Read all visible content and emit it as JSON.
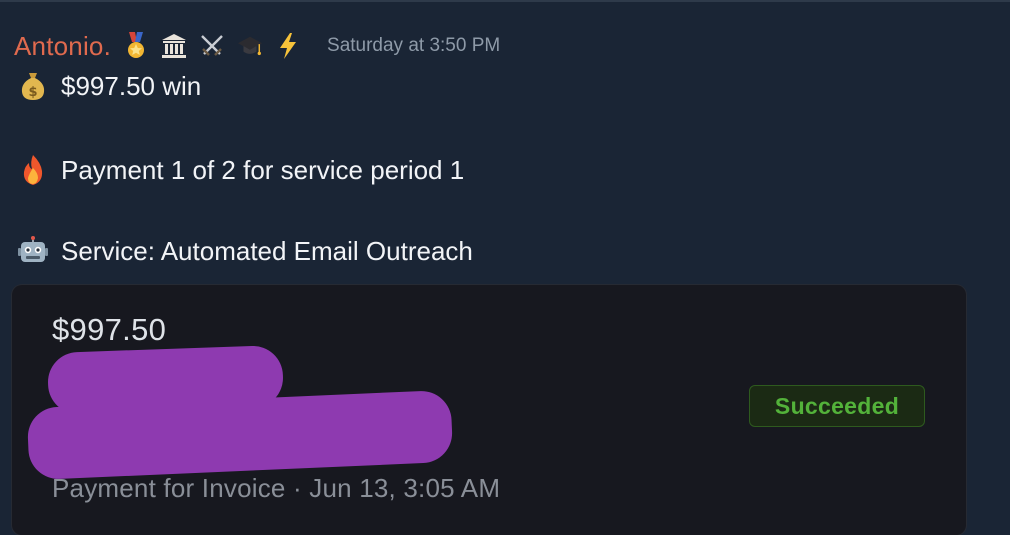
{
  "message": {
    "author": "Antonio.",
    "badges": [
      "medal-icon",
      "classical-building-icon",
      "crossed-swords-icon",
      "graduation-cap-icon",
      "lightning-icon"
    ],
    "timestamp": "Saturday at 3:50 PM",
    "lines": [
      {
        "icon": "money-bag-icon",
        "text": "$997.50 win"
      },
      {
        "icon": "fire-icon",
        "text": "Payment 1 of 2 for service period 1"
      },
      {
        "icon": "robot-icon",
        "text": "Service: Automated Email Outreach"
      }
    ]
  },
  "payment_card": {
    "amount": "$997.50",
    "status": "Succeeded",
    "footer": "Payment for Invoice · Jun 13, 3:05 AM"
  },
  "colors": {
    "background": "#1a2535",
    "author": "#e06a4e",
    "card_background": "#17181f",
    "status_green": "#53b23a",
    "redaction": "#8e3ab0"
  }
}
